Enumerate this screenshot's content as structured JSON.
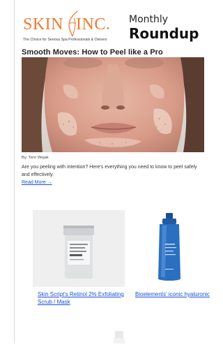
{
  "header": {
    "logo_text": "SKIN INC.",
    "logo_word_left": "SKIN",
    "logo_word_right": "INC.",
    "logo_tagline": "The Choice for Serious Spa Professionals & Owners",
    "monthly": "Monthly",
    "roundup": "Roundup"
  },
  "article": {
    "title": "Smooth Moves: How to Peel like a Pro",
    "byline": "By: Terri Wojak",
    "excerpt": "Are you peeling with intention? Here's everything you need to know to peel safely and effectively.",
    "read_more": "Read More →"
  },
  "products": [
    {
      "caption": "Skin Script's Retinol 2% Exfoliating Scrub / Mask"
    },
    {
      "caption": "Bioelements' iconic hyaluronic"
    }
  ],
  "colors": {
    "brand_orange": "#f07a2f",
    "link_blue": "#1a4fd6"
  }
}
